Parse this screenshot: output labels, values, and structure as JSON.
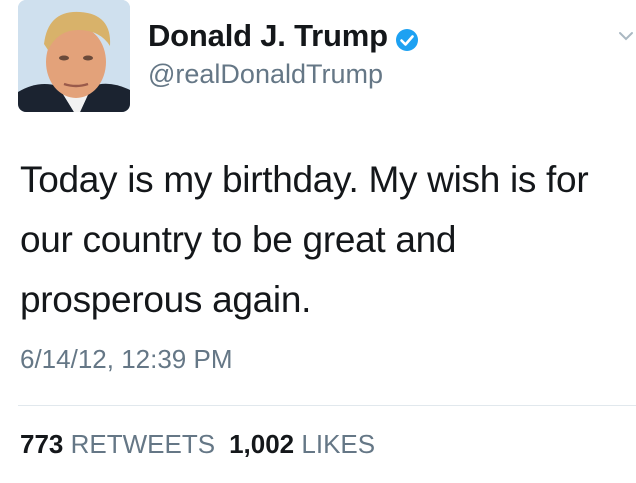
{
  "user": {
    "display_name": "Donald J. Trump",
    "handle": "@realDonaldTrump",
    "verified": true
  },
  "tweet": {
    "text": "Today is my birthday. My wish is for our country to be great and prosperous again.",
    "timestamp": "6/14/12, 12:39 PM"
  },
  "stats": {
    "retweets_count": "773",
    "retweets_label": "RETWEETS",
    "likes_count": "1,002",
    "likes_label": "LIKES"
  },
  "icons": {
    "verified": "verified-badge-icon",
    "menu": "chevron-down-icon"
  },
  "colors": {
    "verified_blue": "#1da1f2",
    "text_primary": "#14171a",
    "text_secondary": "#657786",
    "divider": "#e1e8ed"
  }
}
